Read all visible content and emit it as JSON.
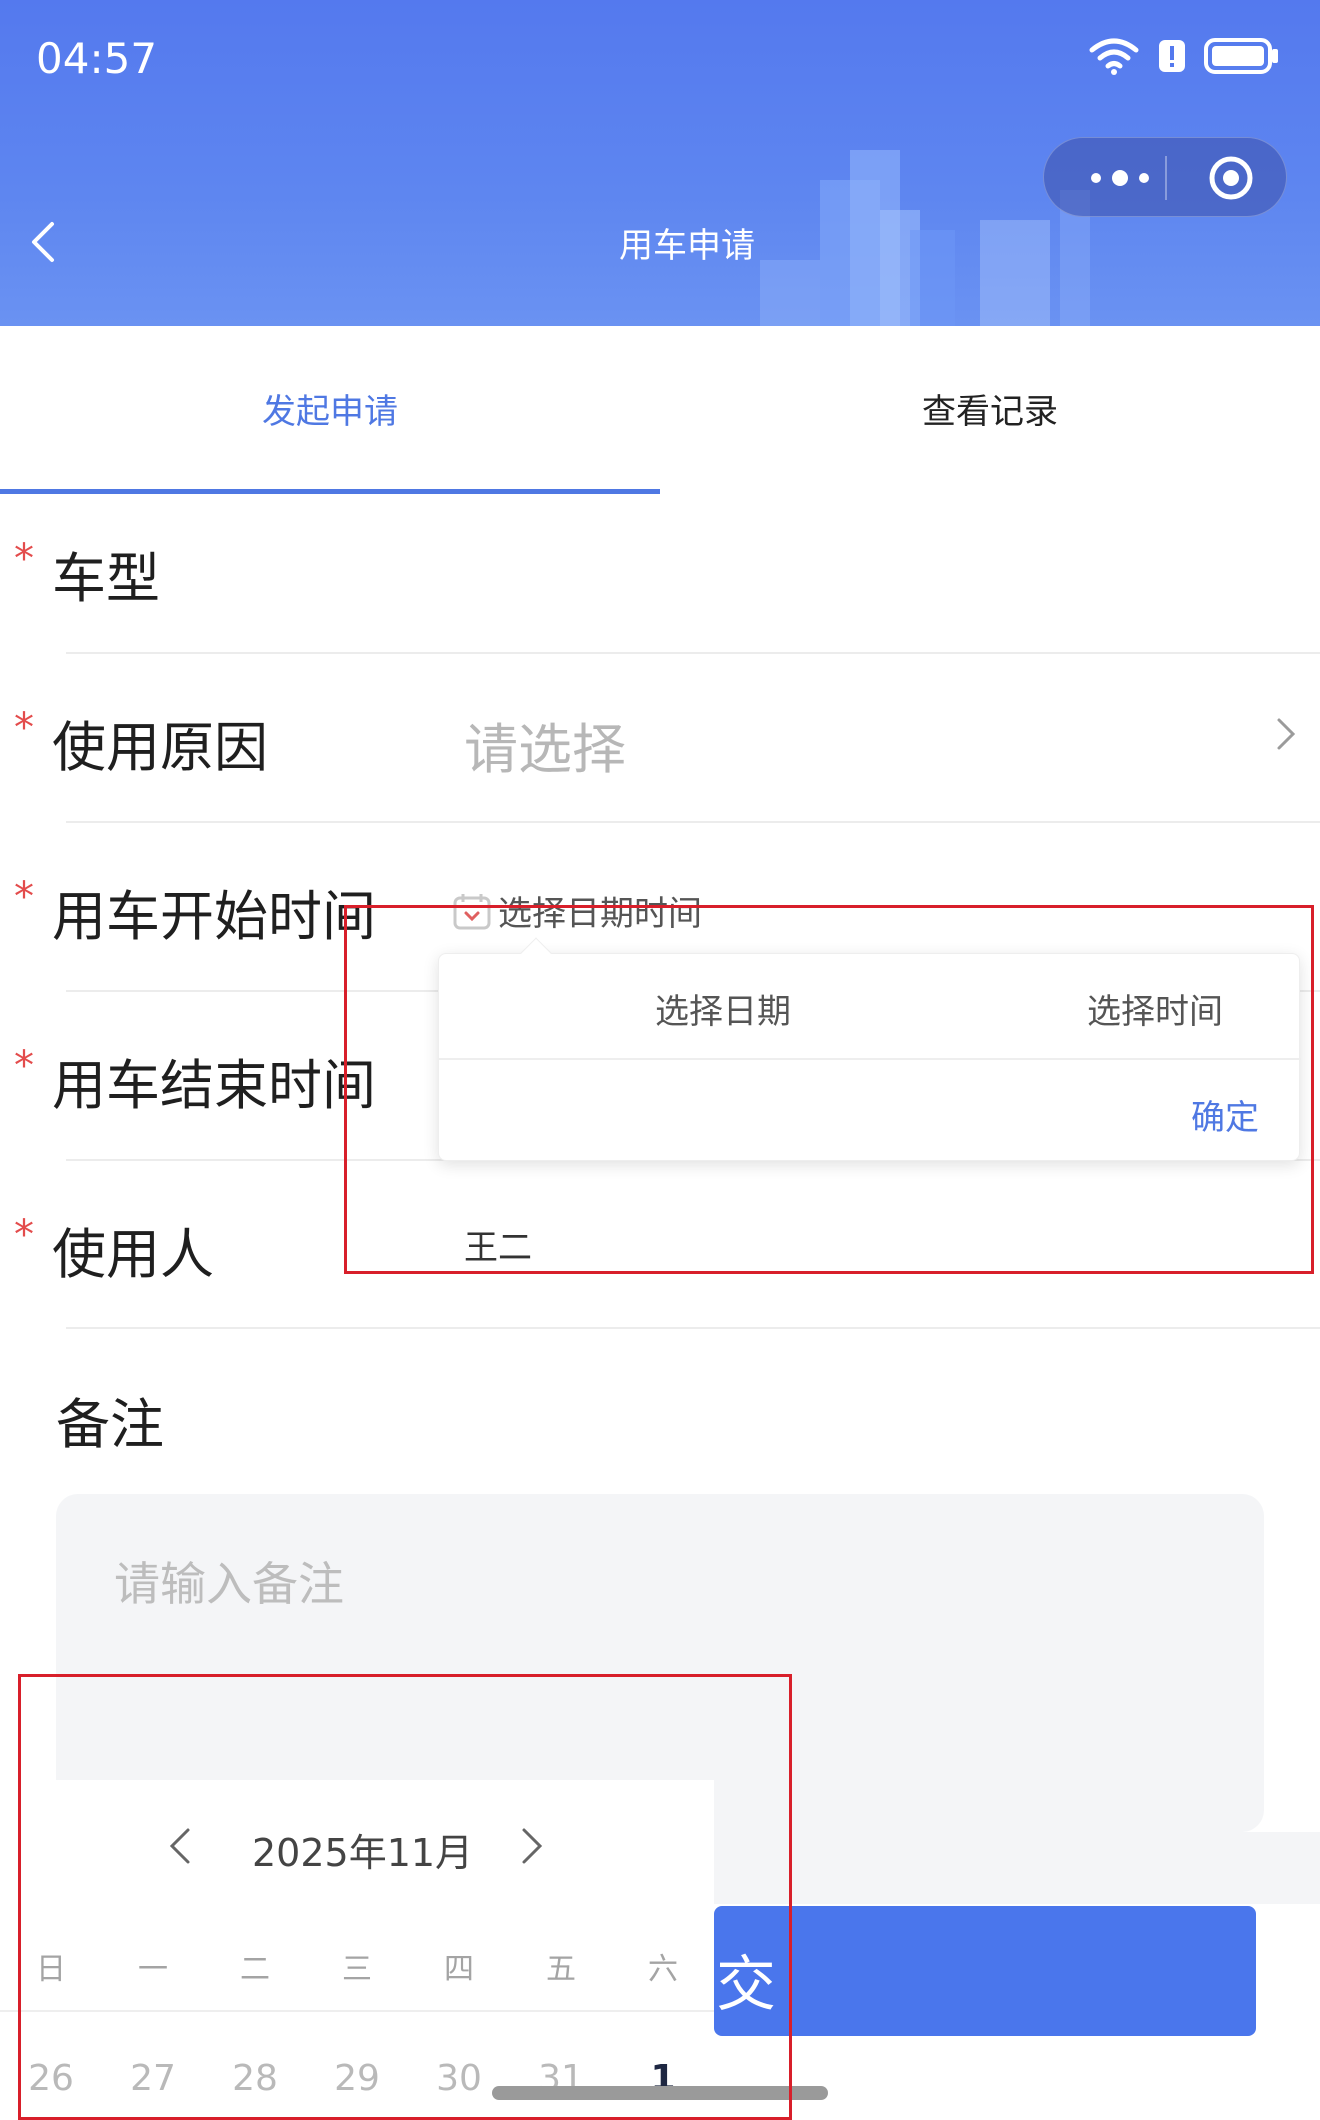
{
  "status_bar": {
    "time": "04:57"
  },
  "nav": {
    "title": "用车申请"
  },
  "tabs": [
    {
      "label": "发起申请",
      "active": true
    },
    {
      "label": "查看记录",
      "active": false
    }
  ],
  "form": {
    "vehicle_type": {
      "required_mark": "*",
      "label": "车型"
    },
    "reason": {
      "required_mark": "*",
      "label": "使用原因",
      "placeholder": "请选择"
    },
    "start_time": {
      "required_mark": "*",
      "label": "用车开始时间",
      "placeholder": "选择日期时间"
    },
    "end_time": {
      "required_mark": "*",
      "label": "用车结束时间"
    },
    "user": {
      "required_mark": "*",
      "label": "使用人",
      "value": "王二"
    },
    "remark": {
      "label": "备注",
      "placeholder": "请输入备注"
    }
  },
  "datetime_popover": {
    "date_tab": "选择日期",
    "time_tab": "选择时间",
    "confirm": "确定"
  },
  "calendar": {
    "month_label": "2025年11月",
    "weekdays": [
      "日",
      "一",
      "二",
      "三",
      "四",
      "五",
      "六"
    ],
    "first_row": [
      "26",
      "27",
      "28",
      "29",
      "30",
      "31",
      "1"
    ]
  },
  "submit_button": {
    "label_visible": "交"
  },
  "colors": {
    "accent": "#4f78e3",
    "header_bg": "#5479ee",
    "required": "#e34c4c",
    "annotation": "#d81f2a",
    "submit": "#4a76ec"
  }
}
